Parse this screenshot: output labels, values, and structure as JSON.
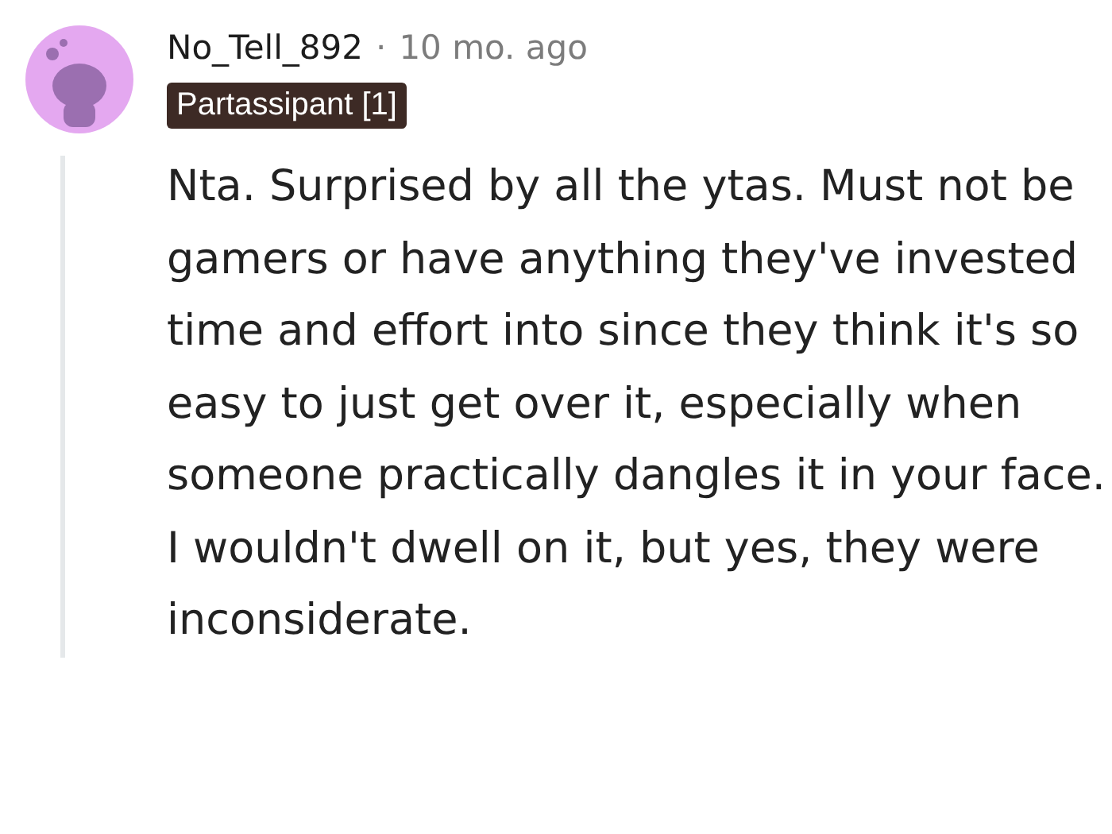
{
  "comment": {
    "author": "No_Tell_892",
    "separator": "·",
    "time": "10 mo. ago",
    "flair": "Partassipant [1]",
    "body": "Nta. Surprised by all the ytas. Must not be gamers or have anything they've invested time and effort into since they think it's so easy to just get over it, especially when someone practically dangles it in your face. I wouldn't dwell on it, but yes, they were inconsiderate."
  }
}
